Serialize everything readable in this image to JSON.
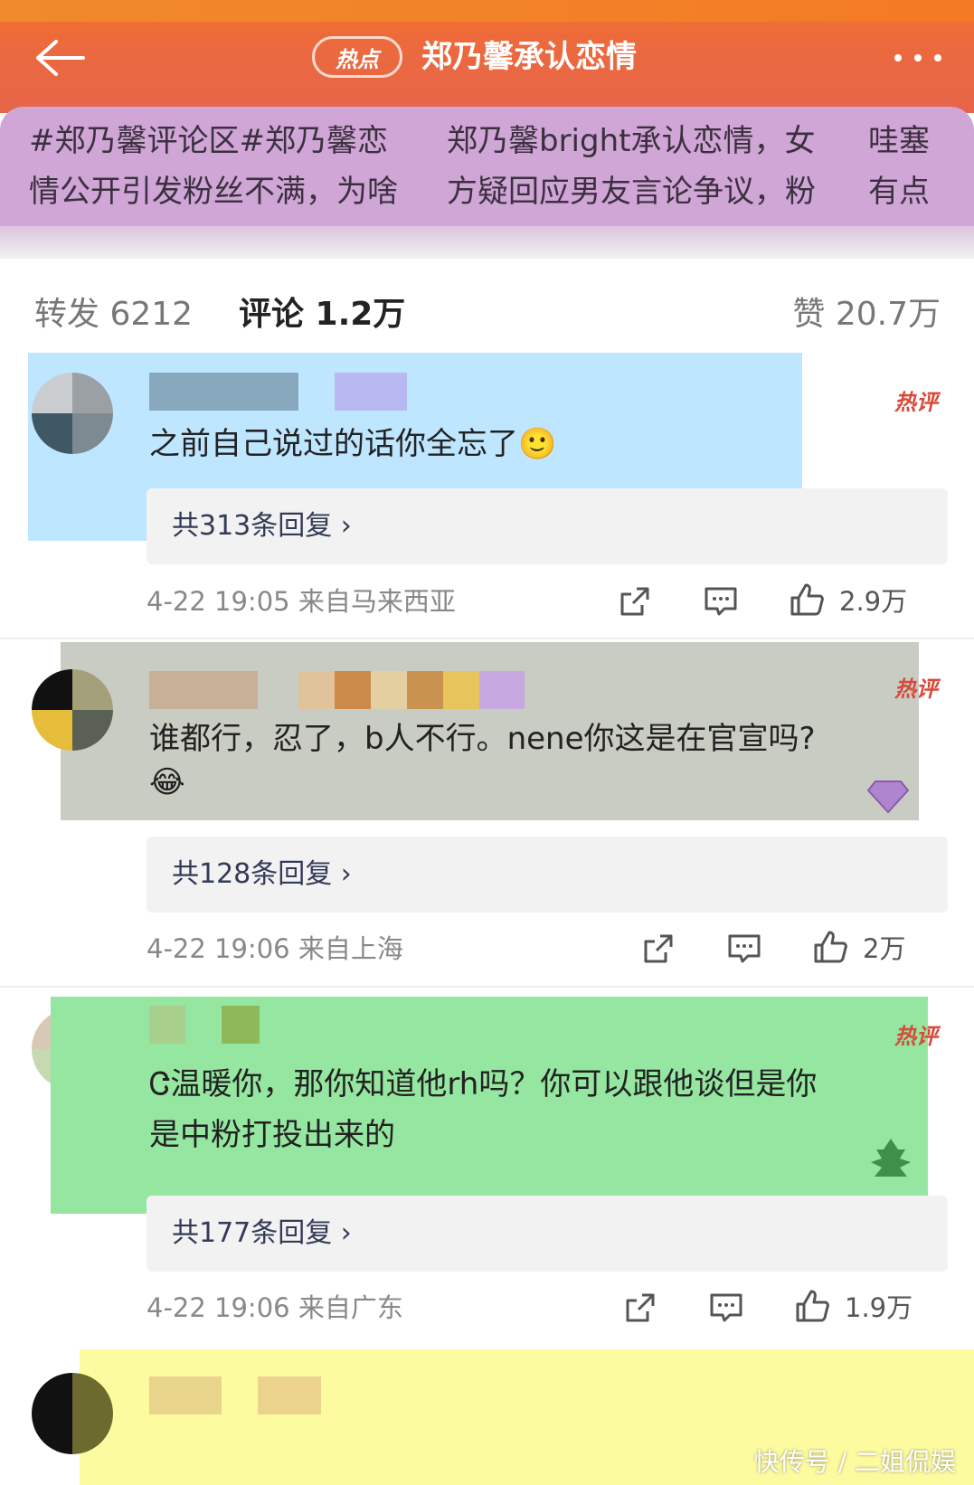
{
  "header": {
    "back_icon": "back-arrow-icon",
    "hot_tag": "热点",
    "title": "郑乃馨承认恋情",
    "more_icon": "more-dots-icon"
  },
  "topics": [
    {
      "line1": "#郑乃馨评论区#郑乃馨恋",
      "line2": "情公开引发粉丝不满，为啥"
    },
    {
      "line1": "郑乃馨bright承认恋情，女",
      "line2": "方疑回应男友言论争议，粉"
    },
    {
      "line1": "哇塞",
      "line2": "有点"
    }
  ],
  "stats": {
    "repost": "转发 6212",
    "comment": "评论 1.2万",
    "like": "赞 20.7万"
  },
  "hot_label": "热评",
  "comments": [
    {
      "text_lines": [
        "之前自己说过的话你全忘了🙂"
      ],
      "replies": "共313条回复 ›",
      "time_loc": "4-22 19:05 来自马来西亚",
      "likes": "2.9万",
      "highlight": "#bfe6ff"
    },
    {
      "text_lines": [
        "谁都行，忍了，b人不行。nene你这是在官宣吗?",
        "😂"
      ],
      "replies": "共128条回复 ›",
      "time_loc": "4-22 19:06 来自上海",
      "likes": "2万",
      "highlight": "#c9ccc2"
    },
    {
      "text_lines": [
        "Ꮳ温暖你，那你知道他rh吗？你可以跟他谈但是你",
        "是中粉打投出来的"
      ],
      "replies": "共177条回复 ›",
      "time_loc": "4-22 19:06 来自广东",
      "likes": "1.9万",
      "highlight": "#95e6a0"
    }
  ],
  "icons": {
    "share": "share-icon",
    "comment": "comment-icon",
    "like": "thumbs-up-icon"
  },
  "watermark": "快传号 / 二姐侃娱",
  "colors": {
    "header": "#ec6a3c",
    "topic_bg": "#cfa6d6",
    "highlight_yellow": "#fdfba0"
  }
}
